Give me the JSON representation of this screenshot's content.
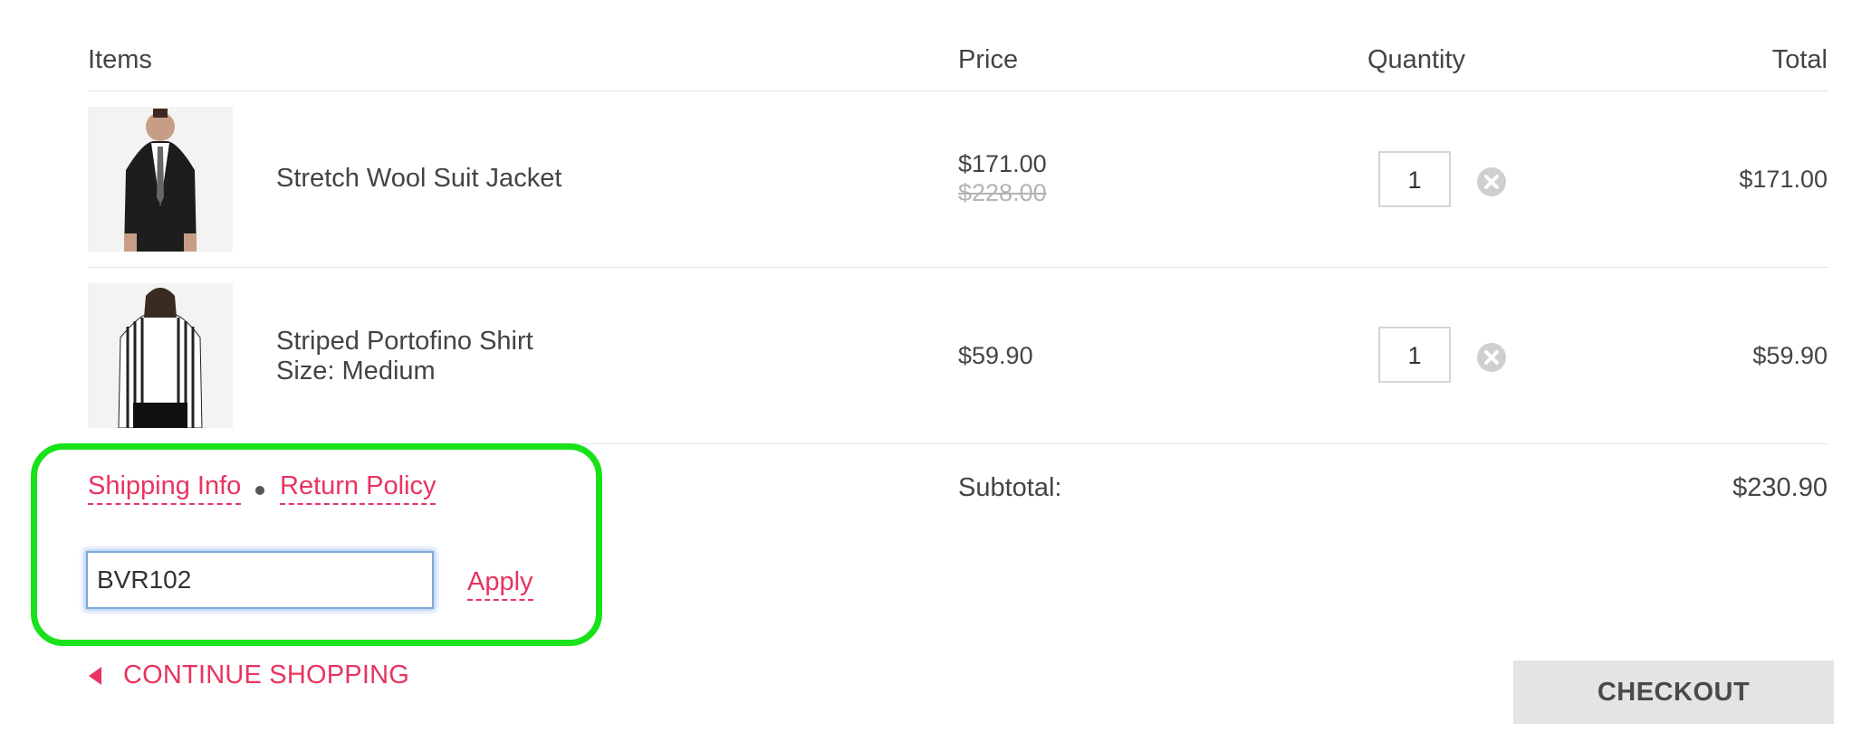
{
  "header": {
    "items": "Items",
    "price": "Price",
    "quantity": "Quantity",
    "total": "Total"
  },
  "cart": [
    {
      "name": "Stretch Wool Suit Jacket",
      "size": "",
      "price": "$171.00",
      "original_price": "$228.00",
      "quantity": "1",
      "total": "$171.00",
      "image": "suit-jacket-photo"
    },
    {
      "name": "Striped Portofino Shirt",
      "size": "Size: Medium",
      "price": "$59.90",
      "original_price": "",
      "quantity": "1",
      "total": "$59.90",
      "image": "striped-shirt-photo"
    }
  ],
  "links": {
    "shipping": "Shipping Info",
    "returns": "Return Policy"
  },
  "promo": {
    "value": "BVR102",
    "apply": "Apply"
  },
  "summary": {
    "subtotal_label": "Subtotal:",
    "subtotal_value": "$230.90"
  },
  "actions": {
    "continue": "CONTINUE SHOPPING",
    "checkout": "CHECKOUT"
  },
  "colors": {
    "accent": "#e8345f",
    "highlight": "#19e21a",
    "checkout_bg": "#e4e4e4"
  },
  "icons": {
    "remove": "close-circle-icon",
    "continue": "caret-left-icon"
  }
}
